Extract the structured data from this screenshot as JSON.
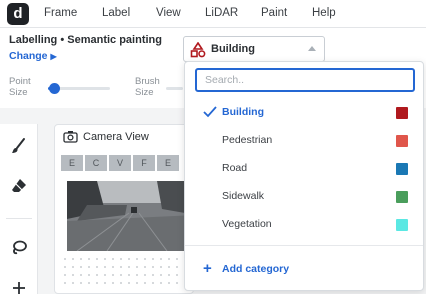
{
  "app": {
    "logo_letter": "d"
  },
  "menu": {
    "items": [
      "Frame",
      "Label",
      "View",
      "LiDAR",
      "Paint",
      "Help"
    ]
  },
  "toolbar": {
    "mode_label": "Labelling • Semantic painting",
    "change_label": "Change",
    "point_size": {
      "label_line1": "Point",
      "label_line2": "Size",
      "value": 0.1
    },
    "brush_size": {
      "label_line1": "Brush",
      "label_line2": "Size"
    }
  },
  "class_select": {
    "value": "Building",
    "icon": "shapes-icon"
  },
  "dropdown": {
    "search_placeholder": "Search..",
    "options": [
      {
        "label": "Building",
        "color": "#b0191e",
        "selected": true
      },
      {
        "label": "Pedestrian",
        "color": "#e0564b",
        "selected": false
      },
      {
        "label": "Road",
        "color": "#1a78b4",
        "selected": false
      },
      {
        "label": "Sidewalk",
        "color": "#4a9e5c",
        "selected": false
      },
      {
        "label": "Vegetation",
        "color": "#5be8e3",
        "selected": false
      }
    ],
    "add_label": "Add category"
  },
  "tools": [
    {
      "icon": "brush-icon"
    },
    {
      "icon": "eraser-icon"
    },
    {
      "icon": "lasso-icon"
    },
    {
      "icon": "move-icon"
    }
  ],
  "camera": {
    "title": "Camera View",
    "tabs": [
      "E",
      "C",
      "V",
      "F",
      "E"
    ]
  },
  "colors": {
    "accent": "#2467d3"
  }
}
